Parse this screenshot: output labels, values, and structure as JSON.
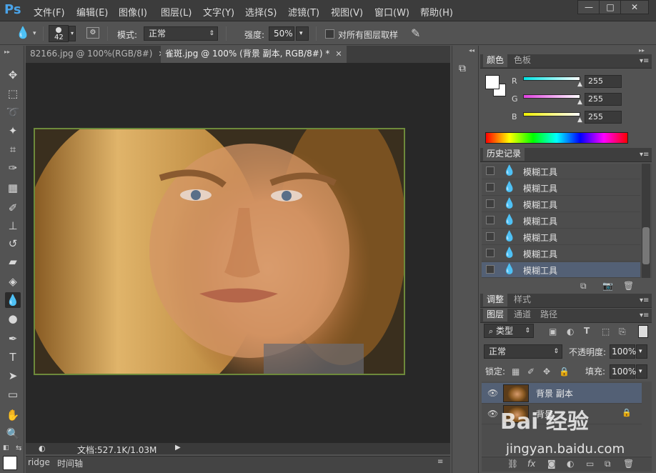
{
  "app": {
    "logo": "Ps"
  },
  "menu": [
    "文件(F)",
    "编辑(E)",
    "图像(I)",
    "图层(L)",
    "文字(Y)",
    "选择(S)",
    "滤镜(T)",
    "视图(V)",
    "窗口(W)",
    "帮助(H)"
  ],
  "window_controls": {
    "minimize": "—",
    "maximize": "□",
    "close": "✕"
  },
  "options": {
    "brush_size": "42",
    "mode_label": "模式:",
    "mode_value": "正常",
    "strength_label": "强度:",
    "strength_value": "50%",
    "sample_all_label": "对所有图层取样"
  },
  "tabs": [
    {
      "label": "82166.jpg @ 100%(RGB/8#)",
      "close": "✕"
    },
    {
      "label": "雀斑.jpg @ 100% (背景 副本, RGB/8#) *",
      "close": "✕"
    }
  ],
  "status": {
    "doc_text": "文档:527.1K/1.03M"
  },
  "bottom_tabs": {
    "tab1": "ridge",
    "tab2": "时间轴"
  },
  "color_panel": {
    "tabs": [
      "颜色",
      "色板"
    ],
    "channels": [
      {
        "label": "R",
        "value": "255",
        "color": "#00e5e5"
      },
      {
        "label": "G",
        "value": "255",
        "color": "#e040e0"
      },
      {
        "label": "B",
        "value": "255",
        "color": "#f0f000"
      }
    ]
  },
  "history_panel": {
    "title": "历史记录",
    "items": [
      "模糊工具",
      "模糊工具",
      "模糊工具",
      "模糊工具",
      "模糊工具",
      "模糊工具",
      "模糊工具"
    ]
  },
  "adjust_panel": {
    "tabs": [
      "调整",
      "样式"
    ]
  },
  "layers_panel": {
    "tabs": [
      "图层",
      "通道",
      "路径"
    ],
    "filter_value": "类型",
    "blend_mode": "正常",
    "opacity_label": "不透明度:",
    "opacity_value": "100%",
    "lock_label": "锁定:",
    "fill_label": "填充:",
    "fill_value": "100%",
    "layers": [
      {
        "name": "背景 副本",
        "active": true
      },
      {
        "name": "背景",
        "active": false
      }
    ]
  },
  "watermark": {
    "logo": "Bai 经验",
    "url": "jingyan.baidu.com"
  }
}
